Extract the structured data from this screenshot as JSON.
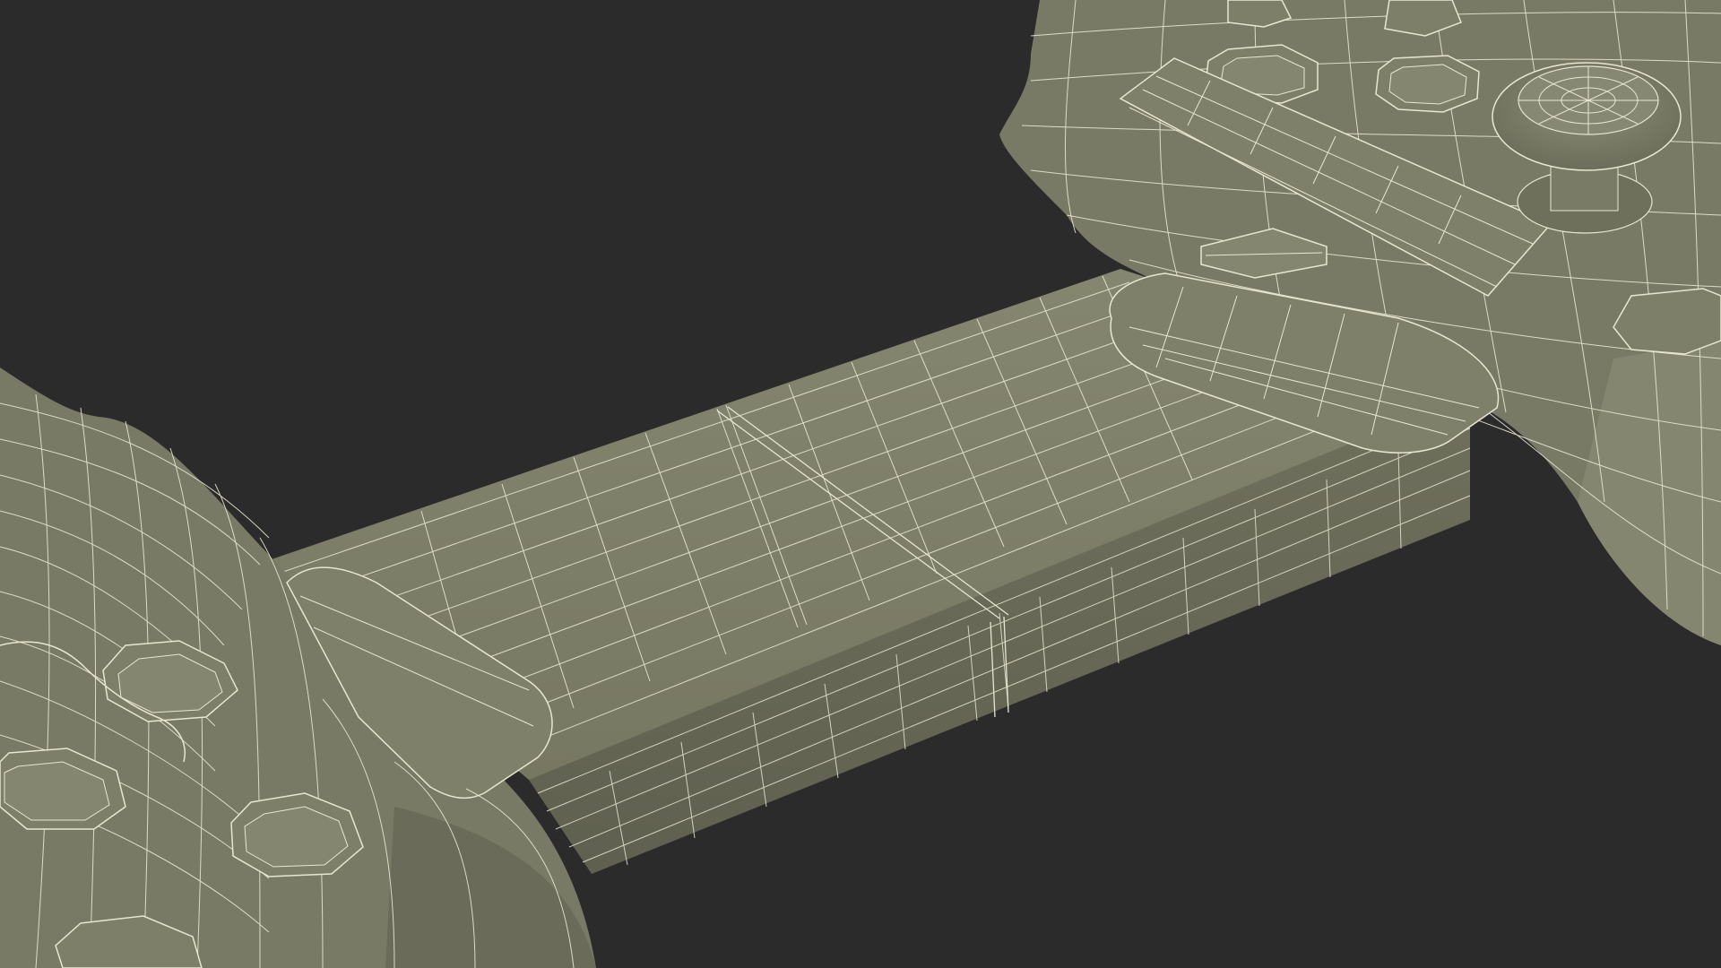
{
  "scene": {
    "subject": "wireframe-render-of-game-controller-grip",
    "colors": {
      "background": "#2b2b2b",
      "surface": "#7b7c68",
      "surface_dark": "#6a6b58",
      "surface_light": "#8a8b76",
      "wire": "#e8e6d0"
    },
    "parts": [
      "left-grip",
      "right-grip",
      "telescoping-bridge",
      "slide-tab-left",
      "slide-tab-right",
      "release-latch",
      "analog-stick",
      "action-buttons",
      "dpad"
    ]
  }
}
